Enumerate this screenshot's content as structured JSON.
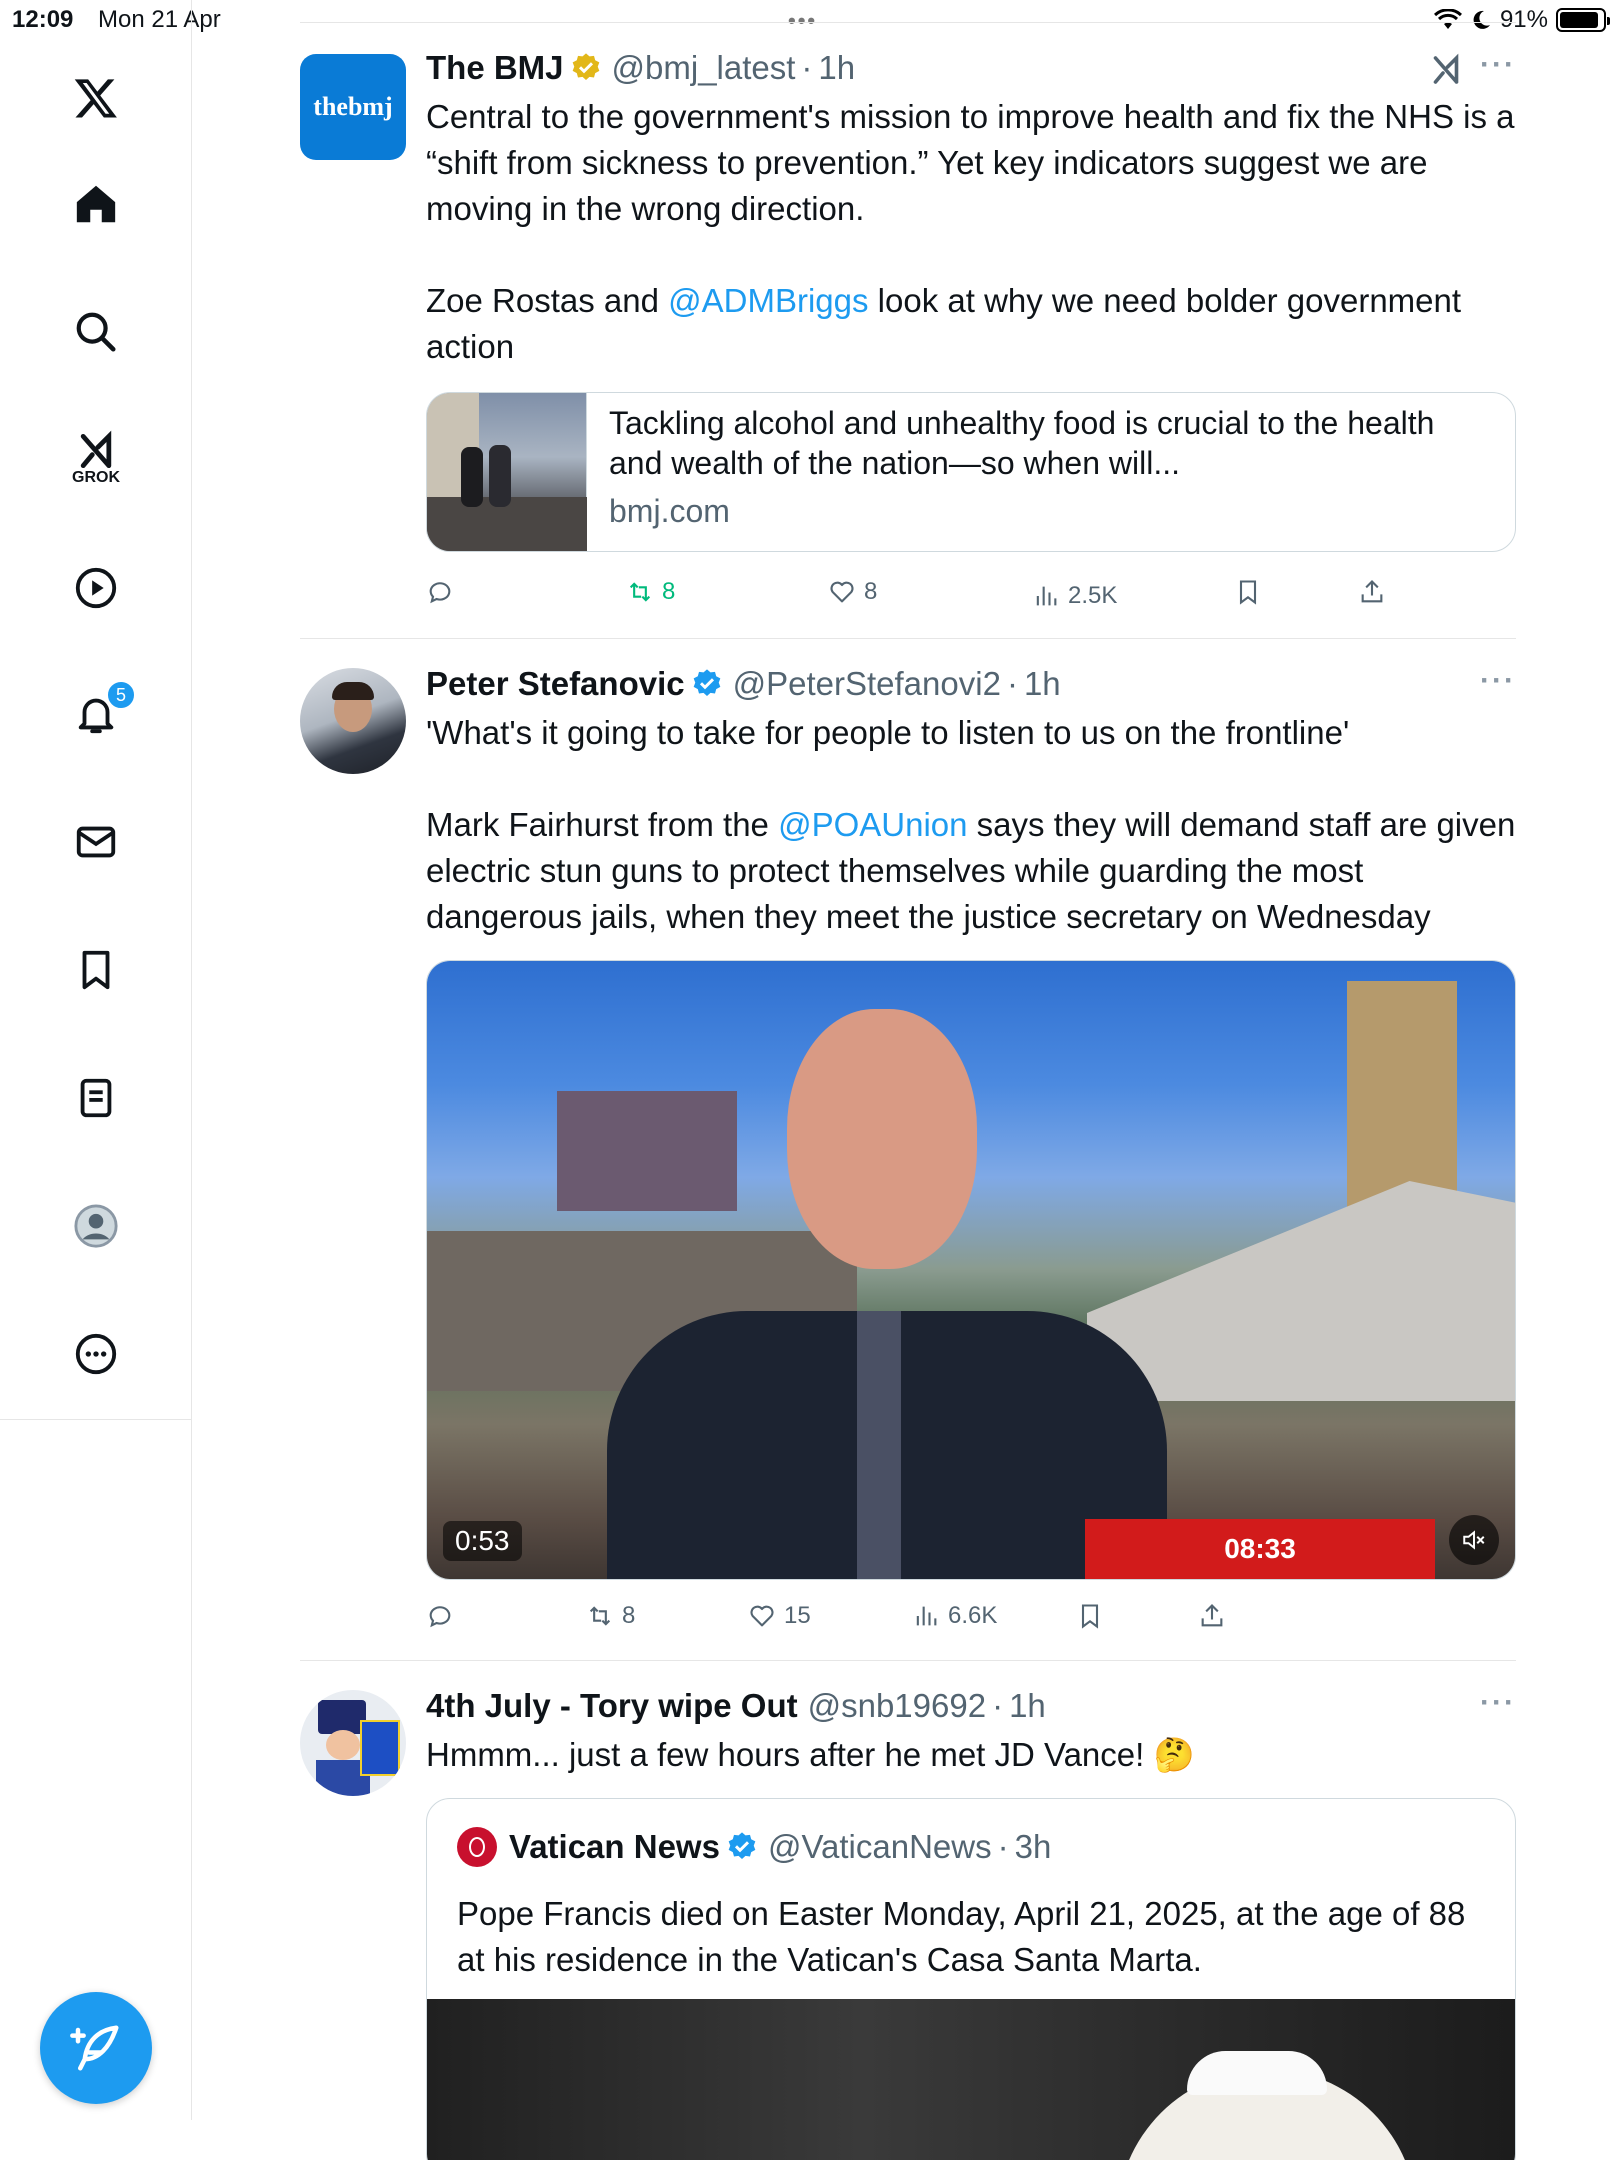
{
  "status_bar": {
    "time": "12:09",
    "date": "Mon 21 Apr",
    "battery": "91%",
    "battery_level": 0.91
  },
  "sidebar": {
    "grok_label": "GROK",
    "notification_count": "5"
  },
  "tweets": [
    {
      "name": "The BMJ",
      "handle": "@bmj_latest",
      "time": "1h",
      "avatar_text": "thebmj",
      "text_1": "Central to the government's mission to improve health and fix the NHS is a “shift from sickness to prevention.” Yet key indicators suggest we are moving in the wrong direction.",
      "text_2_pre": "Zoe Rostas and ",
      "text_2_mention": "@ADMBriggs",
      "text_2_post": " look at why we need bolder government action",
      "card_title": "Tackling alcohol and unhealthy food is crucial to the health and wealth of the nation—so when will...",
      "card_domain": "bmj.com",
      "reposts": "8",
      "likes": "8",
      "views": "2.5K"
    },
    {
      "name": "Peter Stefanovic",
      "handle": "@PeterStefanovi2",
      "time": "1h",
      "text_1": "'What's it going to take for people to listen to us on the frontline'",
      "text_2_pre": "Mark Fairhurst from the ",
      "text_2_mention": "@POAUnion",
      "text_2_post": " says they will demand staff are given electric stun guns to protect themselves while guarding the most dangerous jails, when they meet the justice secretary on Wednesday",
      "video_duration": "0:53",
      "video_clock": "08:33",
      "reposts": "8",
      "likes": "15",
      "views": "6.6K"
    },
    {
      "name": "4th July - Tory wipe Out",
      "handle": "@snb19692",
      "time": "1h",
      "text_1": "Hmmm... just a few hours after he met JD Vance! 🤔",
      "quote": {
        "name": "Vatican News",
        "handle": "@VaticanNews",
        "time": "3h",
        "text": "Pope Francis died on Easter Monday, April 21, 2025, at the age of 88 at his residence in the Vatican's Casa Santa Marta."
      }
    }
  ],
  "colors": {
    "accent": "#1d9bf0",
    "repost_green": "#00ba7c",
    "muted": "#536471"
  }
}
